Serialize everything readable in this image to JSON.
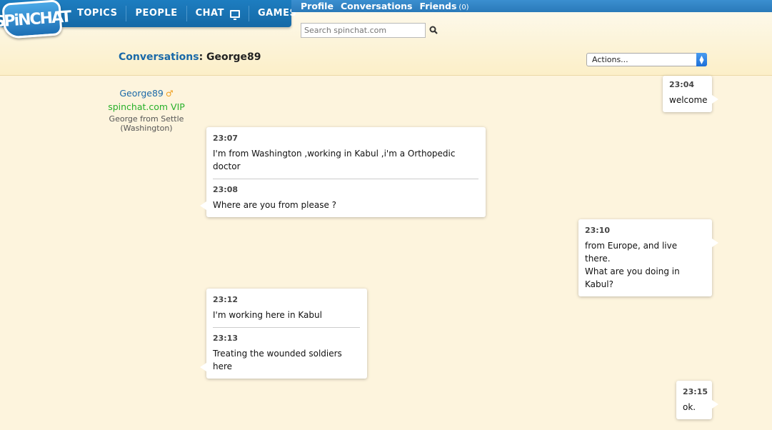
{
  "logo": "SPiNCHAT",
  "nav": {
    "topics": "TOPICS",
    "people": "PEOPLE",
    "chat": "CHAT",
    "games": "GAMES"
  },
  "subnav": {
    "profile": "Profile",
    "conversations": "Conversations",
    "friends": "Friends",
    "friends_count": "(0)"
  },
  "search": {
    "placeholder": "Search spinchat.com"
  },
  "page": {
    "title_label": "Conversations",
    "title_colon": ":",
    "title_user": "George89",
    "actions_label": "Actions..."
  },
  "profile": {
    "name": "George89",
    "gender_symbol": "♂",
    "vip": "spinchat.com VIP",
    "location_line1": "George from Settle",
    "location_line2": "(Washington)"
  },
  "messages": [
    {
      "time": "23:04",
      "lines": [
        "welcome"
      ]
    },
    {
      "time": "23:07",
      "lines": [
        "I'm from Washington ,working in Kabul ,i'm a Orthopedic doctor"
      ]
    },
    {
      "time": "23:08",
      "lines": [
        "Where are you from please ?"
      ]
    },
    {
      "time": "23:10",
      "lines": [
        "from Europe, and live there.",
        "What are you doing in Kabul?"
      ]
    },
    {
      "time": "23:12",
      "lines": [
        "I'm working here in Kabul"
      ]
    },
    {
      "time": "23:13",
      "lines": [
        "Treating the wounded soldiers here"
      ]
    },
    {
      "time": "23:15",
      "lines": [
        "ok."
      ]
    }
  ],
  "colors": {
    "nav_blue": "#1569a6",
    "link_blue": "#1a69a8",
    "vip_green": "#28b02a",
    "page_bg": "#fdf4dd"
  }
}
